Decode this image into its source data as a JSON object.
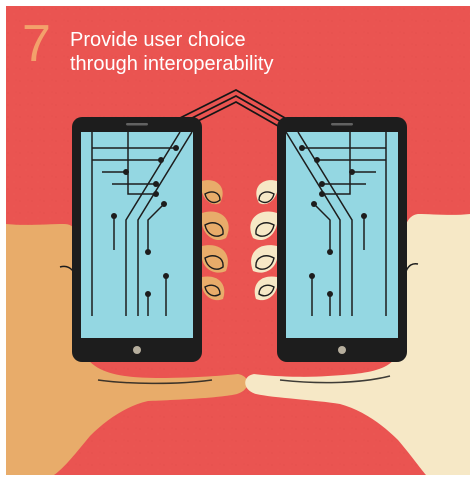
{
  "poster": {
    "number": "7",
    "title_line_1": "Provide user choice",
    "title_line_2": "through interoperability"
  },
  "colors": {
    "background": "#ea5451",
    "number": "#f3a16b",
    "title": "#ffffff",
    "phone_body": "#1d1d1d",
    "screen": "#94d7e2",
    "left_hand": "#e8ac6a",
    "right_hand": "#f6e8c6"
  },
  "icons": [
    "left-hand-icon",
    "right-hand-icon",
    "left-phone-icon",
    "right-phone-icon",
    "circuit-lines-icon"
  ]
}
